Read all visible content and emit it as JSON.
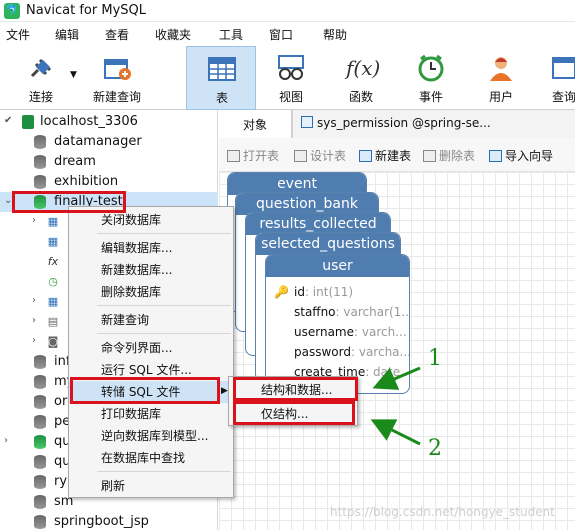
{
  "app": {
    "title": "Navicat for MySQL"
  },
  "menubar": [
    "文件",
    "编辑",
    "查看",
    "收藏夹",
    "工具",
    "窗口",
    "帮助"
  ],
  "toolbar": {
    "connect": "连接",
    "new_query": "新建查询",
    "table": "表",
    "view": "视图",
    "function": "函数",
    "event": "事件",
    "user": "用户",
    "query": "查询"
  },
  "sidebar": {
    "host": "localhost_3306",
    "dbs": [
      "datamanager",
      "dream",
      "exhibition",
      "finally-test"
    ],
    "partial": [
      "inf",
      "my",
      "or",
      "pe",
      "qu",
      "qu",
      "ry",
      "sm"
    ],
    "last": "springboot_jsp"
  },
  "tabs": {
    "objects": "对象",
    "permission": "sys_permission @spring-se..."
  },
  "objbar": {
    "open": "打开表",
    "design": "设计表",
    "new": "新建表",
    "delete": "删除表",
    "import": "导入向导"
  },
  "cards": {
    "titles": [
      "event",
      "question_bank",
      "results_collected",
      "selected_questions",
      "user"
    ],
    "fields": [
      {
        "name": "id",
        "type": ": int(11)"
      },
      {
        "name": "staffno",
        "type": ": varchar(1..."
      },
      {
        "name": "username",
        "type": ": varch..."
      },
      {
        "name": "password",
        "type": ": varcha..."
      },
      {
        "name": "create_time",
        "type": ": date..."
      }
    ]
  },
  "context_menu": [
    "关闭数据库",
    "编辑数据库...",
    "新建数据库...",
    "删除数据库",
    "新建查询",
    "命令列界面...",
    "运行 SQL 文件...",
    "转储 SQL 文件",
    "打印数据库",
    "逆向数据库到模型...",
    "在数据库中查找",
    "刷新"
  ],
  "submenu": [
    "结构和数据...",
    "仅结构..."
  ],
  "annotations": {
    "one": "1",
    "two": "2"
  },
  "watermark": "https://blog.csdn.net/hongye_student"
}
